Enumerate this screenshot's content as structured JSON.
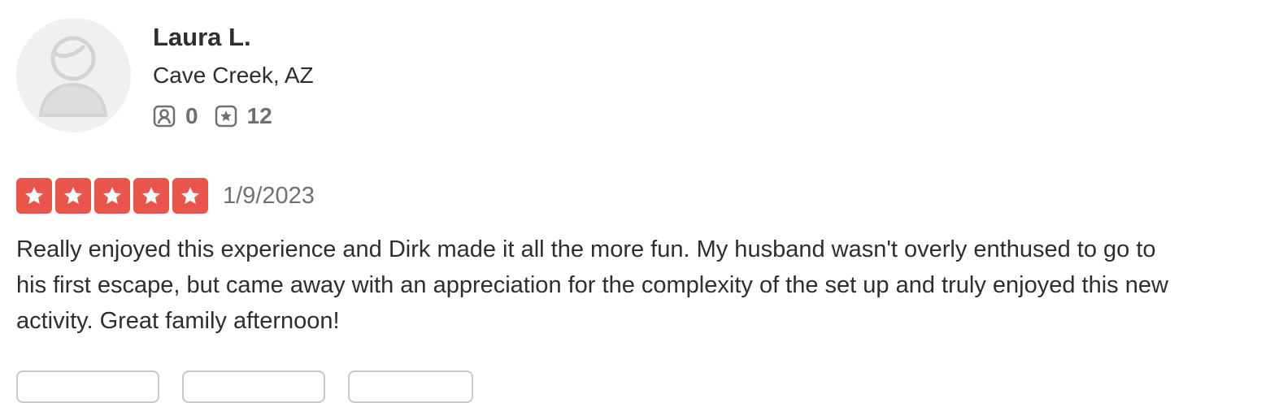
{
  "user": {
    "name": "Laura L.",
    "location": "Cave Creek, AZ",
    "friends_count": "0",
    "reviews_count": "12",
    "avatar_icon": "default-user-avatar-icon"
  },
  "review": {
    "rating": 5,
    "max_rating": 5,
    "star_color": "#e9544b",
    "date": "1/9/2023",
    "text": "Really enjoyed this experience and Dirk made it all the more fun. My husband wasn't overly enthused to go to his first escape, but came away with an appreciation for the complexity of the set up and truly enjoyed this new activity. Great family afternoon!"
  },
  "icons": {
    "friends": "friends-icon",
    "reviews": "review-star-icon",
    "star": "star-icon"
  }
}
